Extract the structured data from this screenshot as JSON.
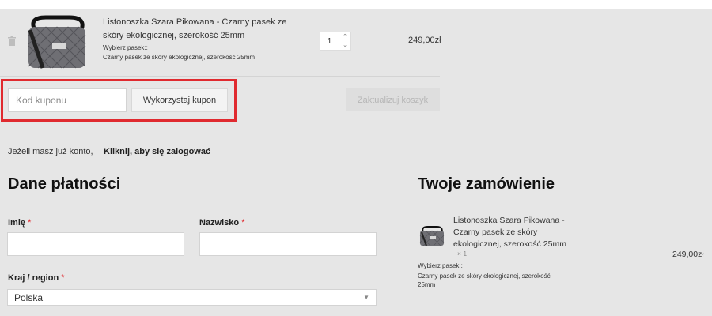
{
  "cart": {
    "item": {
      "name": "Listonoszka Szara Pikowana - Czarny pasek ze skóry ekologicznej, szerokość 25mm",
      "variant_label": "Wybierz pasek::",
      "variant_value": "Czarny pasek ze skóry ekologicznej, szerokość 25mm",
      "quantity": "1",
      "price": "249,00zł"
    },
    "coupon": {
      "placeholder": "Kod kuponu",
      "apply_label": "Wykorzystaj kupon"
    },
    "update_label": "Zaktualizuj koszyk"
  },
  "login": {
    "prompt": "Jeżeli masz już konto,",
    "link": "Kliknij, aby się zalogować"
  },
  "billing": {
    "title": "Dane płatności",
    "first_name_label": "Imię",
    "last_name_label": "Nazwisko",
    "country_label": "Kraj / region",
    "country_value": "Polska",
    "required_mark": "*"
  },
  "order": {
    "title": "Twoje zamówienie",
    "item_name": "Listonoszka Szara Pikowana - Czarny pasek ze skóry ekologicznej, szerokość 25mm",
    "item_qty": "× 1",
    "item_price": "249,00zł",
    "variant_label": "Wybierz pasek::",
    "variant_value": "Czarny pasek ze skóry ekologicznej, szerokość 25mm"
  },
  "icons": {
    "remove": "trash-icon",
    "select": "caret-down-icon"
  },
  "colors": {
    "accent_red": "#e02a2f",
    "page_background": "#e6e6e6"
  }
}
